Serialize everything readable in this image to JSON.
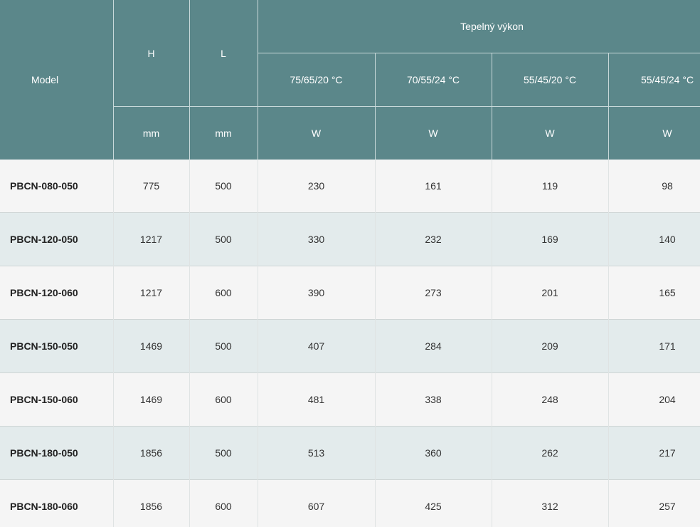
{
  "header": {
    "model": "Model",
    "h": "H",
    "l": "L",
    "group": "Tepelný výkon",
    "temps": [
      "75/65/20 °C",
      "70/55/24 °C",
      "55/45/20 °C",
      "55/45/24 °C"
    ],
    "units": {
      "h": "mm",
      "l": "mm",
      "power": [
        "W",
        "W",
        "W",
        "W"
      ]
    }
  },
  "rows": [
    {
      "model": "PBCN-080-050",
      "h": "775",
      "l": "500",
      "p": [
        "230",
        "161",
        "119",
        "98"
      ]
    },
    {
      "model": "PBCN-120-050",
      "h": "1217",
      "l": "500",
      "p": [
        "330",
        "232",
        "169",
        "140"
      ]
    },
    {
      "model": "PBCN-120-060",
      "h": "1217",
      "l": "600",
      "p": [
        "390",
        "273",
        "201",
        "165"
      ]
    },
    {
      "model": "PBCN-150-050",
      "h": "1469",
      "l": "500",
      "p": [
        "407",
        "284",
        "209",
        "171"
      ]
    },
    {
      "model": "PBCN-150-060",
      "h": "1469",
      "l": "600",
      "p": [
        "481",
        "338",
        "248",
        "204"
      ]
    },
    {
      "model": "PBCN-180-050",
      "h": "1856",
      "l": "500",
      "p": [
        "513",
        "360",
        "262",
        "217"
      ]
    },
    {
      "model": "PBCN-180-060",
      "h": "1856",
      "l": "600",
      "p": [
        "607",
        "425",
        "312",
        "257"
      ]
    }
  ]
}
